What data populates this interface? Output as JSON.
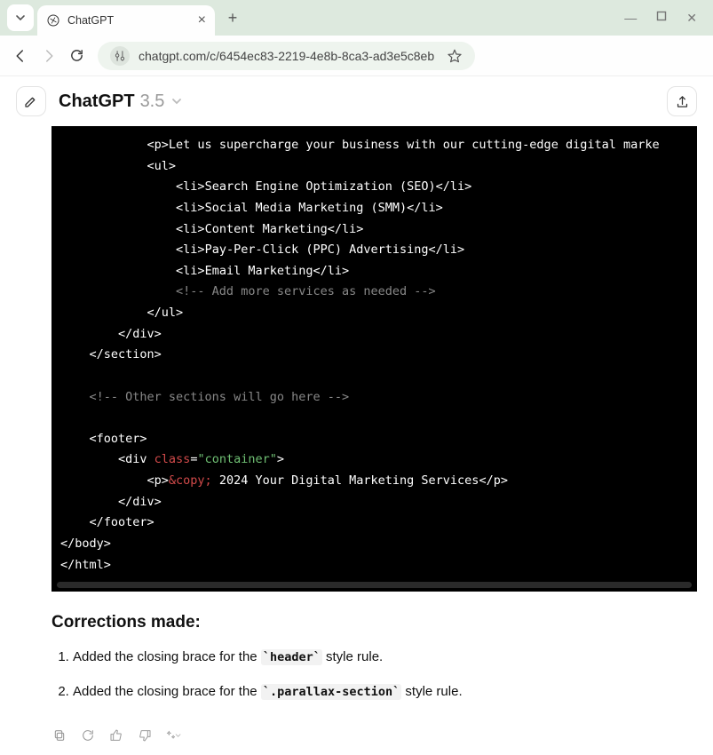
{
  "browser": {
    "tab_title": "ChatGPT",
    "url": "chatgpt.com/c/6454ec83-2219-4e8b-8ca3-ad3e5c8eb"
  },
  "header": {
    "title": "ChatGPT",
    "version": "3.5"
  },
  "code": {
    "l1a": "            <p>",
    "l1b": "Let us supercharge your business with our cutting-edge digital marke",
    "l2": "            <ul>",
    "l3a": "                <li>",
    "l3b": "Search Engine Optimization (SEO)",
    "l3c": "</li>",
    "l4a": "                <li>",
    "l4b": "Social Media Marketing (SMM)",
    "l4c": "</li>",
    "l5a": "                <li>",
    "l5b": "Content Marketing",
    "l5c": "</li>",
    "l6a": "                <li>",
    "l6b": "Pay-Per-Click (PPC) Advertising",
    "l6c": "</li>",
    "l7a": "                <li>",
    "l7b": "Email Marketing",
    "l7c": "</li>",
    "l8": "                <!-- Add more services as needed -->",
    "l9": "            </ul>",
    "l10": "        </div>",
    "l11": "    </section>",
    "blank": " ",
    "l12": "    <!-- Other sections will go here -->",
    "l13": "    <footer>",
    "l14a": "        <div ",
    "l14_attr": "class",
    "l14_eq": "=",
    "l14_val": "\"container\"",
    "l14b": ">",
    "l15a": "            <p>",
    "l15_ent": "&copy;",
    "l15b": " 2024 Your Digital Marketing Services",
    "l15c": "</p>",
    "l16": "        </div>",
    "l17": "    </footer>",
    "l18": "</body>",
    "l19": "</html>"
  },
  "corrections": {
    "heading": "Corrections made:",
    "item1_pre": "Added the closing brace for the ",
    "item1_code": "`header`",
    "item1_post": " style rule.",
    "item2_pre": "Added the closing brace for the ",
    "item2_code": "`.parallax-section`",
    "item2_post": " style rule."
  }
}
